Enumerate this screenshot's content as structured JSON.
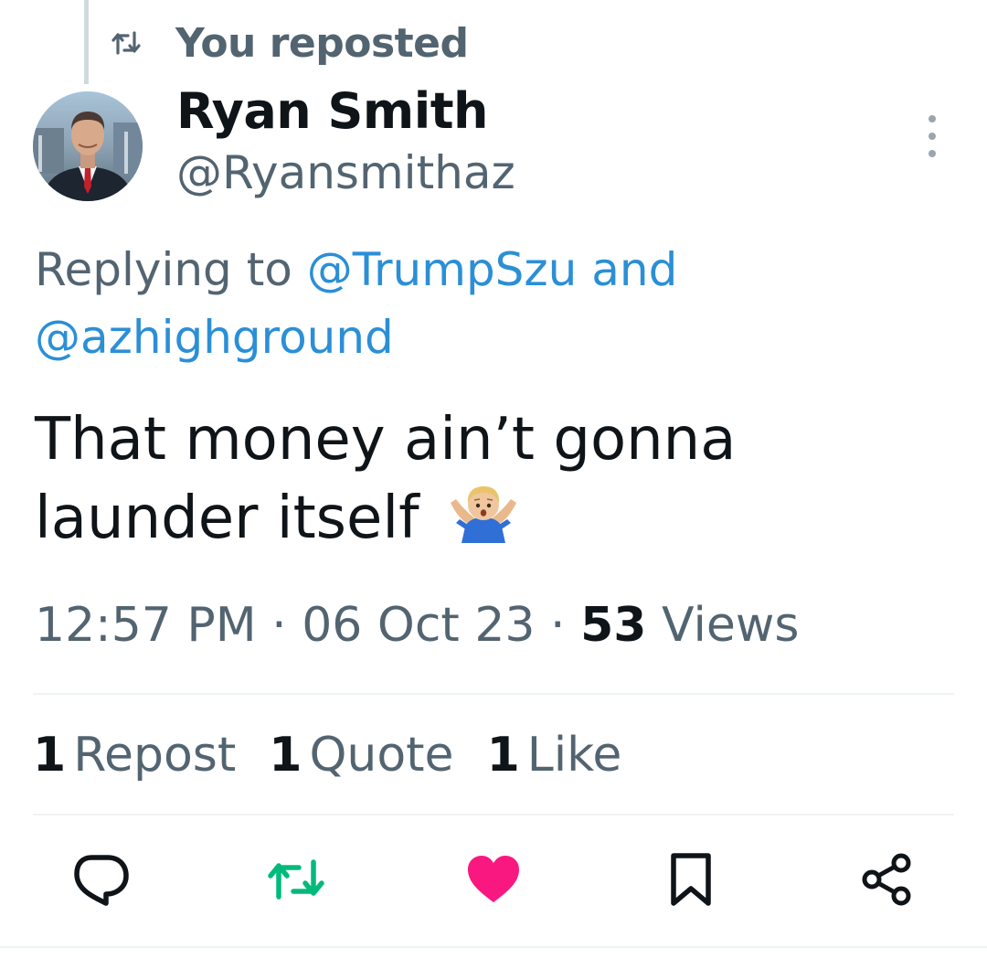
{
  "repost_banner": {
    "label": "You reposted",
    "icon": "repost-icon"
  },
  "author": {
    "display_name": "Ryan Smith",
    "handle": "@Ryansmithaz",
    "avatar": "profile-photo"
  },
  "more_icon": "more-vertical-icon",
  "reply_context": {
    "prefix": "Replying to",
    "mention_1": "@TrumpSzu",
    "conjunction": "and",
    "mention_2": "@azhighground"
  },
  "tweet": {
    "line_1": "That money ain’t gonna",
    "line_2": "launder itself",
    "emoji": "person-shrugging-emoji"
  },
  "meta": {
    "time": "12:57 PM",
    "separator": "·",
    "date": "06 Oct 23",
    "views_count": "53",
    "views_label": "Views"
  },
  "stats": {
    "reposts_count": "1",
    "reposts_label": "Repost",
    "quotes_count": "1",
    "quotes_label": "Quote",
    "likes_count": "1",
    "likes_label": "Like"
  },
  "actions": [
    {
      "name": "reply",
      "icon": "comment-icon"
    },
    {
      "name": "repost",
      "icon": "repost-icon",
      "active": true
    },
    {
      "name": "like",
      "icon": "heart-icon",
      "active": true
    },
    {
      "name": "bookmark",
      "icon": "bookmark-icon"
    },
    {
      "name": "share",
      "icon": "share-icon"
    }
  ],
  "colors": {
    "text_primary": "#0f1419",
    "text_secondary": "#536471",
    "link": "#2b8fd6",
    "repost_active": "#00ba7c",
    "like_active": "#f91880",
    "divider": "#eff3f4"
  }
}
